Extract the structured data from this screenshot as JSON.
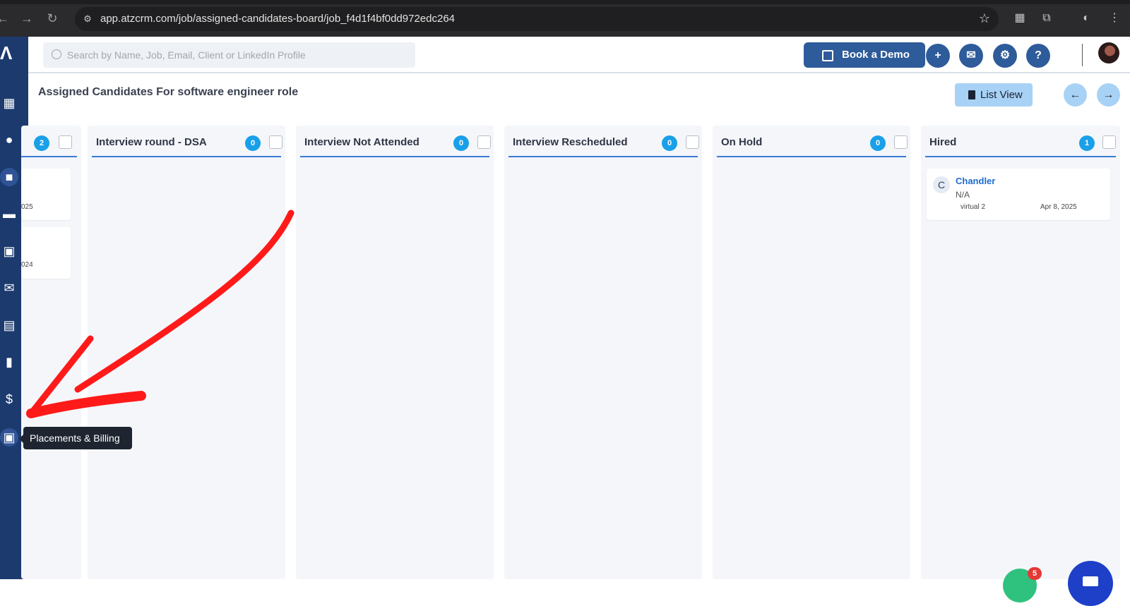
{
  "browser": {
    "url": "app.atzcrm.com/job/assigned-candidates-board/job_f4d1f4bf0dd972edc264"
  },
  "header": {
    "search_placeholder": "Search by Name, Job, Email, Client or LinkedIn Profile",
    "book_demo_label": "Book a Demo"
  },
  "page": {
    "title": "Assigned Candidates For software engineer role",
    "list_view_label": "List View"
  },
  "sidebar": {
    "tooltip": "Placements & Billing",
    "icons": [
      "dashboard-icon",
      "user-icon",
      "briefcase-icon",
      "add-company-icon",
      "contact-card-icon",
      "mail-icon",
      "calendar-icon",
      "analytics-icon",
      "dollar-icon",
      "placements-billing-icon"
    ]
  },
  "board": {
    "columns": [
      {
        "title": "",
        "count": "2",
        "cards": [
          {
            "date_fragment": "025"
          },
          {
            "date_fragment": "024"
          }
        ]
      },
      {
        "title": "Interview round - DSA",
        "count": "0",
        "cards": []
      },
      {
        "title": "Interview Not Attended",
        "count": "0",
        "cards": []
      },
      {
        "title": "Interview Rescheduled",
        "count": "0",
        "cards": []
      },
      {
        "title": "On Hold",
        "count": "0",
        "cards": []
      },
      {
        "title": "Hired",
        "count": "1",
        "cards": [
          {
            "initial": "C",
            "name": "Chandler",
            "subtitle": "N/A",
            "meta_left": "virtual 2",
            "meta_right": "Apr 8, 2025"
          }
        ]
      }
    ]
  },
  "notifications": {
    "badge_count": "5"
  },
  "colors": {
    "sidebar": "#1c3a6e",
    "primary": "#2e5b9a",
    "count_badge": "#1aa0e8",
    "column_underline": "#3a7bd5",
    "annotation": "#ff1a1a"
  }
}
